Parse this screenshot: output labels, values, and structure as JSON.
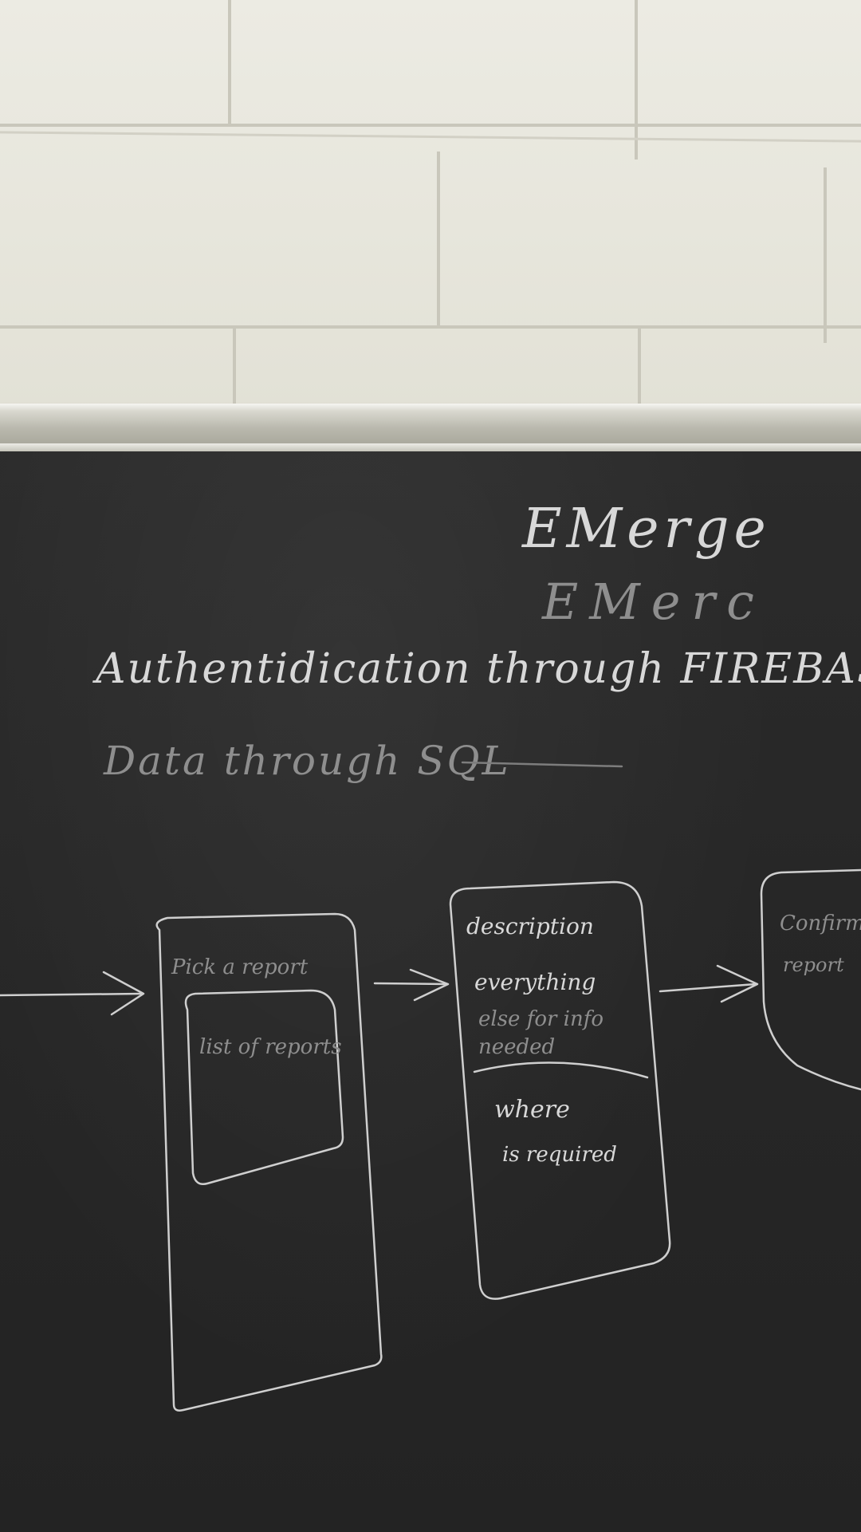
{
  "board_text": {
    "title_line1": "EMerge",
    "title_line2": "EMerc",
    "line_auth": "Authentidication through FIREBASE",
    "line_data": "Data through SQL"
  },
  "screens": [
    {
      "header": "Pick a report",
      "inner_box": "list of reports"
    },
    {
      "line1": "description",
      "line2": "everything",
      "line3": "else for info",
      "line4": "needed",
      "line5": "where",
      "line6": "is required"
    },
    {
      "line1": "Confirm",
      "line2": "report"
    }
  ]
}
